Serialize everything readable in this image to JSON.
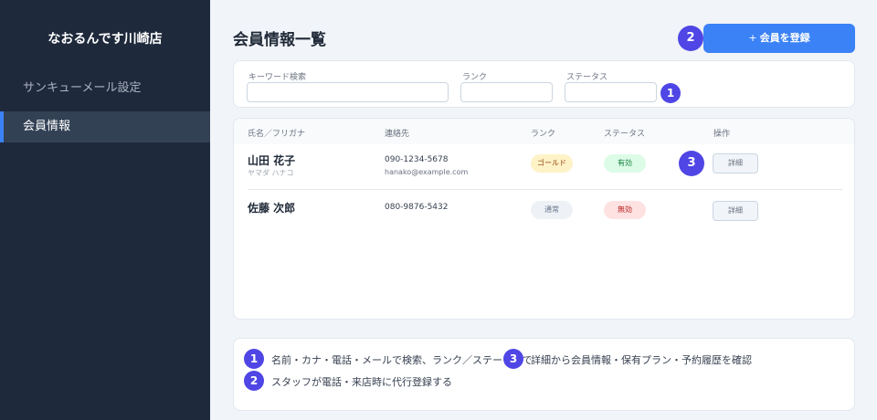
{
  "sidebar": {
    "store_name": "なおるんです川崎店",
    "items": [
      {
        "label": "サンキューメール設定",
        "active": false
      },
      {
        "label": "会員情報",
        "active": true
      }
    ]
  },
  "header": {
    "title": "会員情報一覧",
    "register_plus": "+",
    "register_label": "会員を登録"
  },
  "filters": {
    "keyword_label": "キーワード検索",
    "keyword_value": "",
    "rank_label": "ランク",
    "rank_value": "",
    "status_label": "ステータス",
    "status_value": ""
  },
  "table": {
    "columns": [
      "氏名／フリガナ",
      "連絡先",
      "ランク",
      "ステータス",
      "操作"
    ],
    "rows": [
      {
        "name": "山田 花子",
        "kana": "ヤマダ ハナコ",
        "phone": "090-1234-5678",
        "email": "hanako@example.com",
        "rank": "ゴールド",
        "status": "有効",
        "action": "詳細"
      },
      {
        "name": "佐藤 次郎",
        "kana": "",
        "phone": "080-9876-5432",
        "email": "",
        "rank": "通常",
        "status": "無効",
        "action": "詳細"
      }
    ]
  },
  "markers": {
    "m1": "1",
    "m2": "2",
    "m3": "3"
  },
  "notes": [
    {
      "num": "1",
      "text": "名前・カナ・電話・メールで検索、ランク／ステータスで絞り込み"
    },
    {
      "num": "2",
      "text": "スタッフが電話・来店時に代行登録する"
    },
    {
      "num": "3",
      "text": "詳細から会員情報・保有プラン・予約履歴を確認"
    }
  ],
  "colors": {
    "sidebar_bg": "#1e293b",
    "accent": "#3b82f6",
    "marker": "#4f46e5",
    "rank_gold_bg": "#fef3c7",
    "rank_normal_bg": "#eef2f7",
    "status_active_bg": "#dcfce7",
    "status_inactive_bg": "#fee2e2"
  }
}
